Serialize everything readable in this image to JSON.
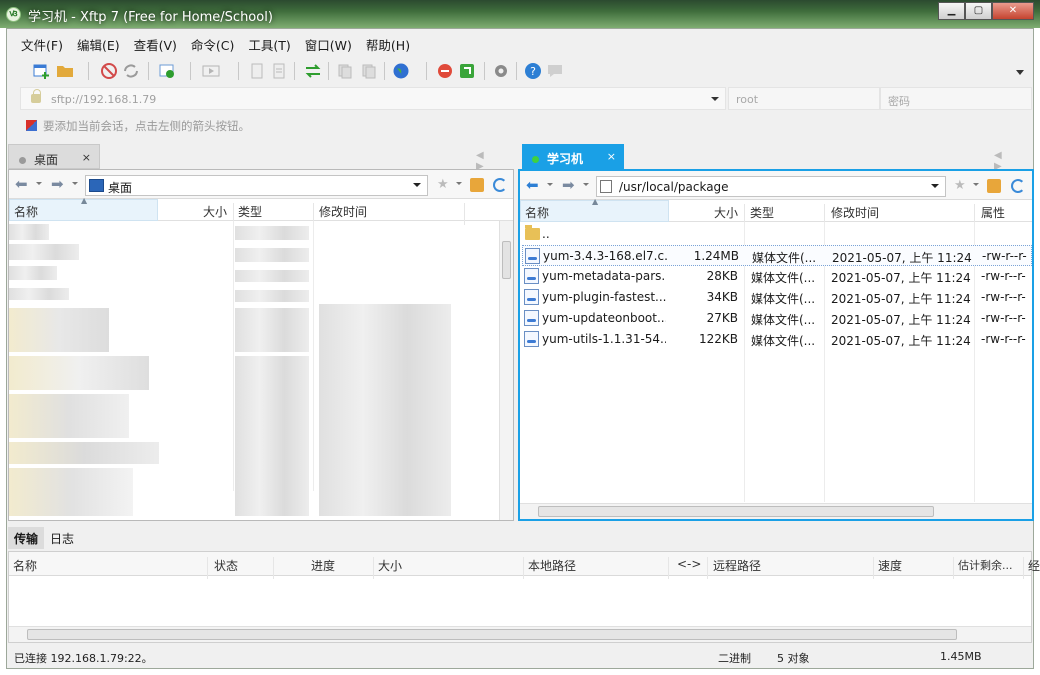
{
  "window": {
    "title": "学习机 - Xftp 7 (Free for Home/School)",
    "min": "▁",
    "max": "▢",
    "close": "✕"
  },
  "menu": [
    "文件(F)",
    "编辑(E)",
    "查看(V)",
    "命令(C)",
    "工具(T)",
    "窗口(W)",
    "帮助(H)"
  ],
  "address": {
    "value": "sftp://192.168.1.79",
    "user_placeholder": "root",
    "password_placeholder": "密码"
  },
  "hint": "要添加当前会话，点击左侧的箭头按钮。",
  "left_tab": {
    "label": "桌面",
    "close": "×"
  },
  "right_tab": {
    "label": "学习机",
    "close": "×"
  },
  "tab_nav": "◀ ▶",
  "left_pane": {
    "path": "桌面",
    "columns": [
      "名称",
      "大小",
      "类型",
      "修改时间"
    ]
  },
  "right_pane": {
    "path": "/usr/local/package",
    "columns": [
      "名称",
      "大小",
      "类型",
      "修改时间",
      "属性"
    ],
    "parent": "..",
    "files": [
      {
        "name": "yum-3.4.3-168.el7.c...",
        "size": "1.24MB",
        "type": "媒体文件(...",
        "modified": "2021-05-07, 上午 11:24",
        "attr": "-rw-r--r-"
      },
      {
        "name": "yum-metadata-pars...",
        "size": "28KB",
        "type": "媒体文件(...",
        "modified": "2021-05-07, 上午 11:24",
        "attr": "-rw-r--r-"
      },
      {
        "name": "yum-plugin-fastest...",
        "size": "34KB",
        "type": "媒体文件(...",
        "modified": "2021-05-07, 上午 11:24",
        "attr": "-rw-r--r-"
      },
      {
        "name": "yum-updateonboot...",
        "size": "27KB",
        "type": "媒体文件(...",
        "modified": "2021-05-07, 上午 11:24",
        "attr": "-rw-r--r-"
      },
      {
        "name": "yum-utils-1.1.31-54....",
        "size": "122KB",
        "type": "媒体文件(...",
        "modified": "2021-05-07, 上午 11:24",
        "attr": "-rw-r--r-"
      }
    ]
  },
  "bottom_tabs": [
    "传输",
    "日志"
  ],
  "transfer_columns": [
    "名称",
    "状态",
    "进度",
    "大小",
    "本地路径",
    "<->",
    "远程路径",
    "速度",
    "估计剩余...",
    "经"
  ],
  "status": {
    "connection": "已连接 192.168.1.79:22。",
    "mode": "二进制",
    "objects": "5 对象",
    "size": "1.45MB"
  },
  "colors": {
    "accent": "#1aa0e6",
    "titlebar": "#3f6d3c"
  }
}
